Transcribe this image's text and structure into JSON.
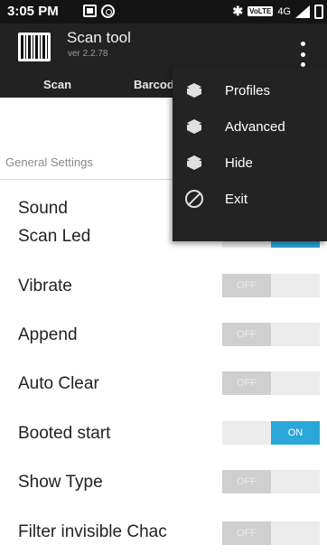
{
  "status_bar": {
    "time": "3:05 PM",
    "volte": "VoLTE",
    "network": "4G",
    "icons": [
      "screenshot-icon",
      "sync-icon",
      "bluetooth-icon",
      "signal-icon",
      "battery-icon"
    ]
  },
  "app_bar": {
    "title": "Scan tool",
    "version": "ver 2.2.78",
    "tabs": [
      {
        "label": "Scan"
      },
      {
        "label": "Barcode"
      }
    ]
  },
  "overflow_menu": {
    "items": [
      {
        "label": "Profiles",
        "icon": "cube-icon"
      },
      {
        "label": "Advanced",
        "icon": "cube-icon"
      },
      {
        "label": "Hide",
        "icon": "cube-icon"
      },
      {
        "label": "Exit",
        "icon": "block-icon"
      }
    ]
  },
  "settings": {
    "section_title": "General Settings",
    "items": [
      {
        "label": "Sound",
        "state": ""
      },
      {
        "label": "Scan Led",
        "state": "ON"
      },
      {
        "label": "Vibrate",
        "state": "OFF"
      },
      {
        "label": "Append",
        "state": "OFF"
      },
      {
        "label": "Auto Clear",
        "state": "OFF"
      },
      {
        "label": "Booted start",
        "state": "ON"
      },
      {
        "label": "Show Type",
        "state": "OFF"
      },
      {
        "label": "Filter invisible Chac",
        "state": "OFF"
      }
    ]
  },
  "colors": {
    "toggle_on": "#2aa7d8",
    "app_bar": "#222222",
    "menu": "#232323"
  }
}
